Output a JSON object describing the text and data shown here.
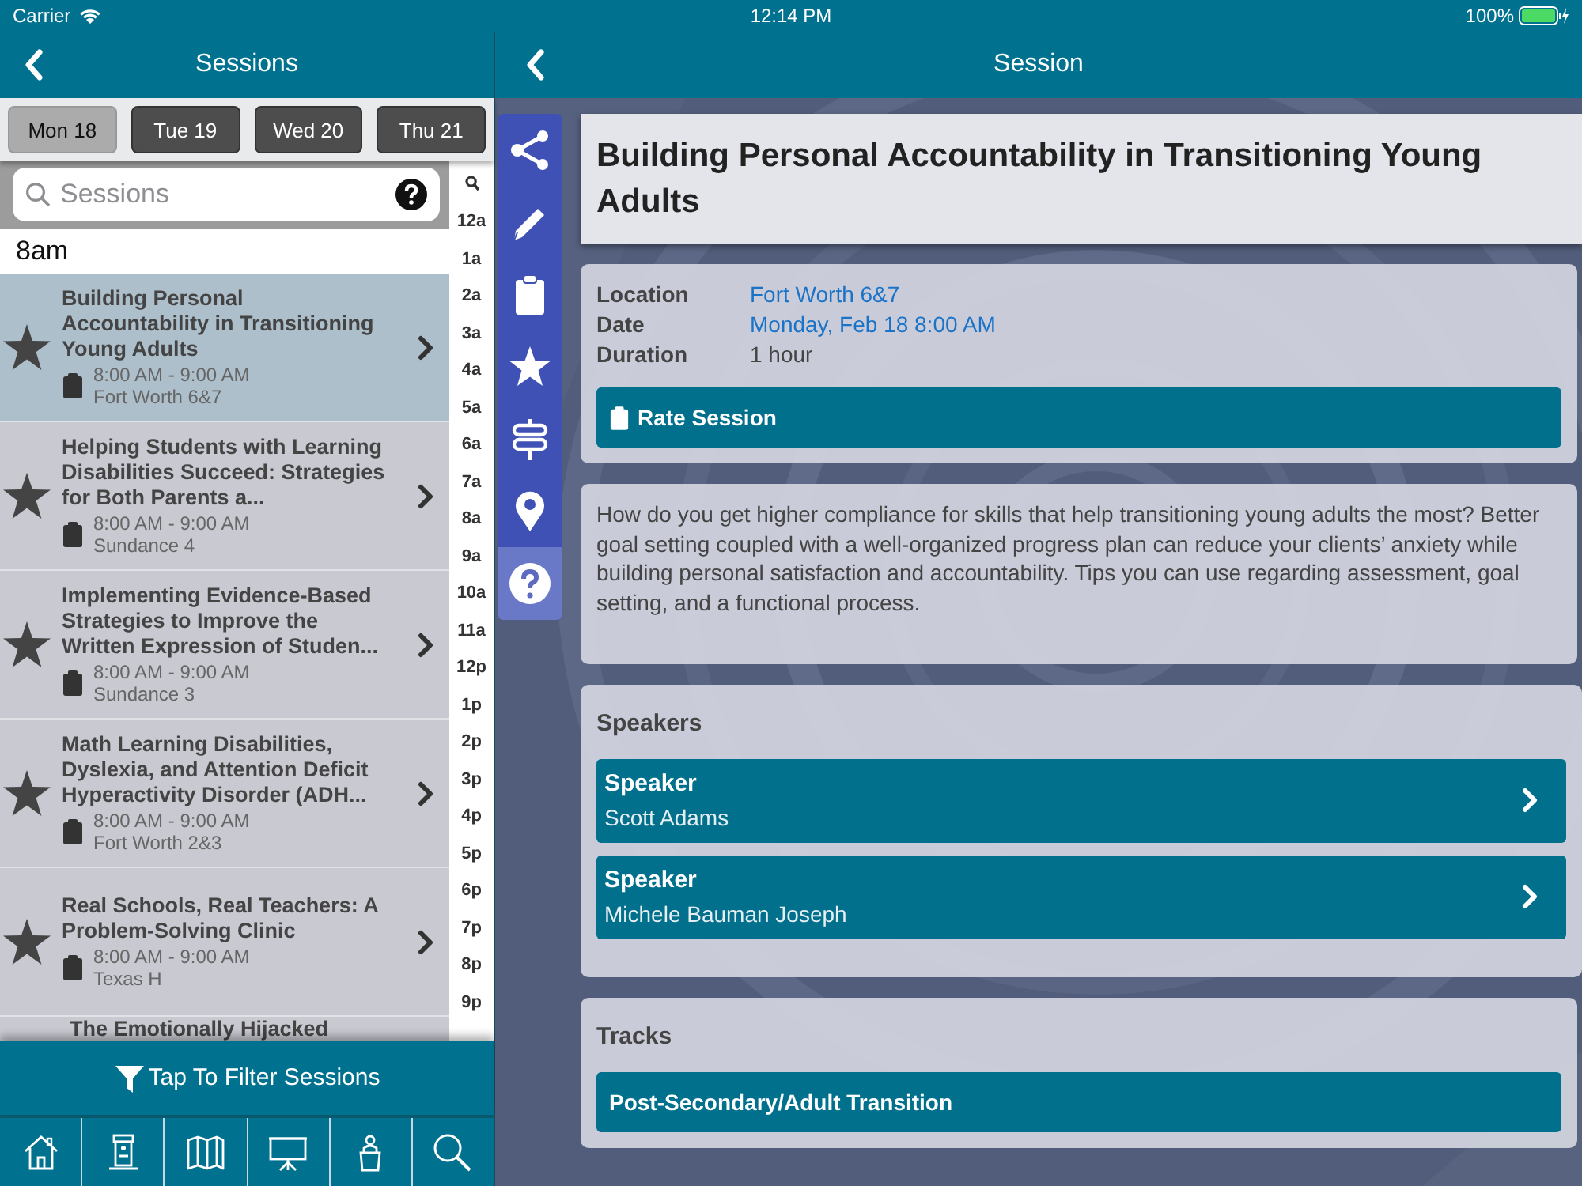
{
  "status_bar": {
    "carrier": "Carrier",
    "time": "12:14 PM",
    "battery": "100%"
  },
  "sessions_pane": {
    "nav_title": "Sessions",
    "days": [
      {
        "label": "Mon 18",
        "selected": true
      },
      {
        "label": "Tue 19",
        "selected": false
      },
      {
        "label": "Wed 20",
        "selected": false
      },
      {
        "label": "Thu 21",
        "selected": false
      }
    ],
    "search": {
      "placeholder": "Sessions"
    },
    "index": [
      "12a",
      "1a",
      "2a",
      "3a",
      "4a",
      "5a",
      "6a",
      "7a",
      "8a",
      "9a",
      "10a",
      "11a",
      "12p",
      "1p",
      "2p",
      "3p",
      "4p",
      "5p",
      "6p",
      "7p",
      "8p",
      "9p"
    ],
    "section_header": "8am",
    "sessions": [
      {
        "title": "Building Personal Accountability in Transitioning Young Adults",
        "time": "8:00 AM - 9:00 AM",
        "room": "Fort Worth 6&7",
        "selected": true
      },
      {
        "title": "Helping Students with Learning Disabilities Succeed: Strategies for Both Parents a...",
        "time": "8:00 AM - 9:00 AM",
        "room": "Sundance 4",
        "selected": false
      },
      {
        "title": "Implementing Evidence-Based Strategies to Improve the Written Expression of Studen...",
        "time": "8:00 AM - 9:00 AM",
        "room": "Sundance 3",
        "selected": false
      },
      {
        "title": "Math Learning Disabilities, Dyslexia, and Attention Deficit Hyperactivity Disorder (ADH...",
        "time": "8:00 AM - 9:00 AM",
        "room": "Fort Worth 2&3",
        "selected": false
      },
      {
        "title": "Real Schools, Real Teachers: A Problem-Solving Clinic",
        "time": "8:00 AM - 9:00 AM",
        "room": "Texas H",
        "selected": false
      },
      {
        "title": "The Emotionally Hijacked",
        "selected": false
      }
    ],
    "filter_button": "Tap To Filter Sessions"
  },
  "session_pane": {
    "nav_title": "Session",
    "side_toolbar": [
      {
        "selected": false
      },
      {
        "selected": false
      },
      {
        "selected": false
      },
      {
        "selected": false
      },
      {
        "selected": false
      },
      {
        "selected": false
      },
      {
        "selected": true
      }
    ],
    "title": "Building Personal Accountability in Transitioning Young Adults",
    "details": [
      {
        "label": "Location",
        "value": "Fort Worth 6&7",
        "kind": "link"
      },
      {
        "label": "Date",
        "value": "Monday, Feb 18 8:00 AM",
        "kind": "link"
      },
      {
        "label": "Duration",
        "value": "1 hour",
        "kind": "text"
      }
    ],
    "rate_button": "Rate Session",
    "description": "How do you get higher compliance for skills that help transitioning young adults the most? Better goal setting coupled with a well-organized progress plan can reduce your clients’ anxiety while building personal satisfaction and accountability. Tips you can use regarding assessment, goal setting, and a functional process.",
    "speakers": {
      "heading": "Speakers",
      "items": [
        {
          "role": "Speaker",
          "name": "Scott Adams"
        },
        {
          "role": "Speaker",
          "name": "Michele Bauman Joseph"
        }
      ]
    },
    "tracks": {
      "heading": "Tracks",
      "items": [
        "Post-Secondary/Adult Transition"
      ]
    }
  }
}
